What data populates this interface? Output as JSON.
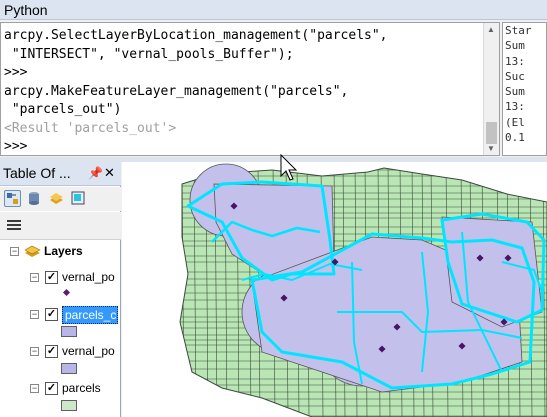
{
  "python_window": {
    "title": "Python",
    "lines": [
      {
        "text": "arcpy.SelectLayerByLocation_management(\"parcels\",",
        "kind": "code"
      },
      {
        "text": " \"INTERSECT\", \"vernal_pools_Buffer\");",
        "kind": "code"
      },
      {
        "text": ">>>",
        "kind": "prompt"
      },
      {
        "text": "arcpy.MakeFeatureLayer_management(\"parcels\",",
        "kind": "code"
      },
      {
        "text": " \"parcels_out\")",
        "kind": "code"
      },
      {
        "text": "<Result 'parcels_out'>",
        "kind": "result"
      },
      {
        "text": ">>>",
        "kind": "prompt"
      }
    ],
    "help_lines": [
      "Star",
      "Sum",
      "13:",
      "Suc",
      "Sum",
      "13:",
      "(El",
      "0.1"
    ]
  },
  "toc": {
    "title": "Table Of ...",
    "pin_icon": "pin-icon",
    "close_icon": "close-icon",
    "root": "Layers",
    "layers": [
      {
        "name": "vernal_po",
        "checked": true,
        "symbol": "point",
        "color": "#5a1f6e"
      },
      {
        "name": "parcels_c",
        "checked": true,
        "symbol": "polygon",
        "color": "#b8b5e8",
        "selected": true
      },
      {
        "name": "vernal_po",
        "checked": true,
        "symbol": "polygon",
        "color": "#b8b5e8"
      },
      {
        "name": "parcels",
        "checked": true,
        "symbol": "polygon",
        "color": "#cce8c8"
      }
    ]
  },
  "map": {
    "colors": {
      "parcels_fill": "#b9e6b4",
      "parcels_line": "#3a4a3a",
      "buffer_fill": "#c3c0ec",
      "selection": "#00e5ff",
      "points": "#4a1464"
    }
  }
}
